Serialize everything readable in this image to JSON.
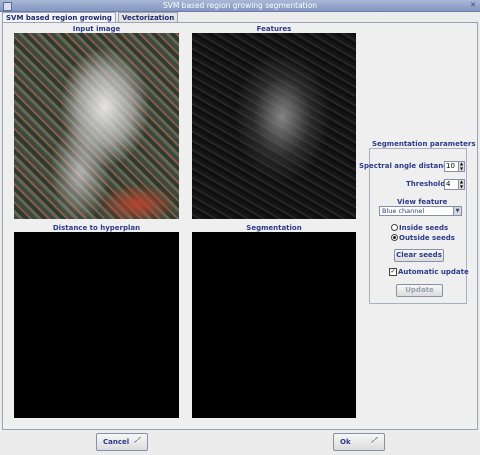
{
  "window": {
    "title": "SVM based region growing segmentation"
  },
  "tabs": [
    {
      "label": "SVM based region growing"
    },
    {
      "label": "Vectorization"
    }
  ],
  "views": {
    "input_image": "Input image",
    "features": "Features",
    "distance": "Distance to hyperplan",
    "segmentation": "Segmentation"
  },
  "params": {
    "title": "Segmentation parameters",
    "spectral_label": "Spectral angle distances",
    "spectral_value": "10",
    "thresholds_label": "Thresholds",
    "thresholds_value": "4",
    "view_feature_label": "View feature",
    "view_feature_value": "Blue channel",
    "inside_seeds": "Inside seeds",
    "outside_seeds": "Outside seeds",
    "selected_seeds": "outside",
    "clear_seeds": "Clear seeds",
    "automatic_update": "Automatic update",
    "automatic_update_checked": true,
    "update": "Update"
  },
  "footer": {
    "cancel": "Cancel",
    "ok": "Ok"
  }
}
